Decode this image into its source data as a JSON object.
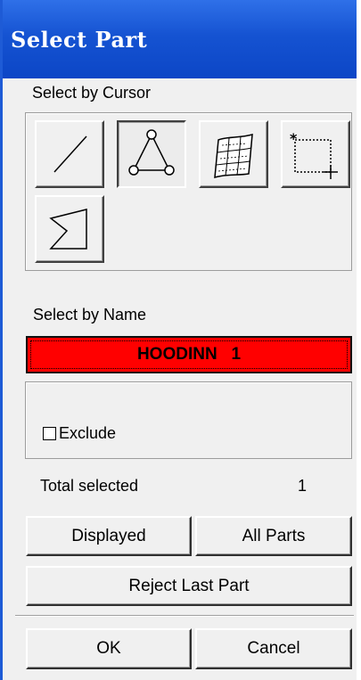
{
  "window": {
    "title": "Select Part"
  },
  "cursor_section": {
    "label": "Select by Cursor",
    "tools": [
      {
        "icon": "line-icon",
        "pressed": false
      },
      {
        "icon": "triangle-nodes-icon",
        "pressed": true
      },
      {
        "icon": "mesh-surface-icon",
        "pressed": false
      },
      {
        "icon": "box-select-icon",
        "pressed": false
      },
      {
        "icon": "polygon-select-icon",
        "pressed": false
      }
    ]
  },
  "name_section": {
    "label": "Select by Name",
    "value": "HOODINN   1"
  },
  "exclude": {
    "label": "Exclude",
    "checked": false
  },
  "summary": {
    "label": "Total selected",
    "value": "1"
  },
  "buttons": {
    "displayed": "Displayed",
    "all_parts": "All Parts",
    "reject_last": "Reject Last Part",
    "ok": "OK",
    "cancel": "Cancel"
  },
  "colors": {
    "titlebar": "#1553d2",
    "name_field": "#ff0000",
    "dialog_bg": "#f0f0f0"
  }
}
